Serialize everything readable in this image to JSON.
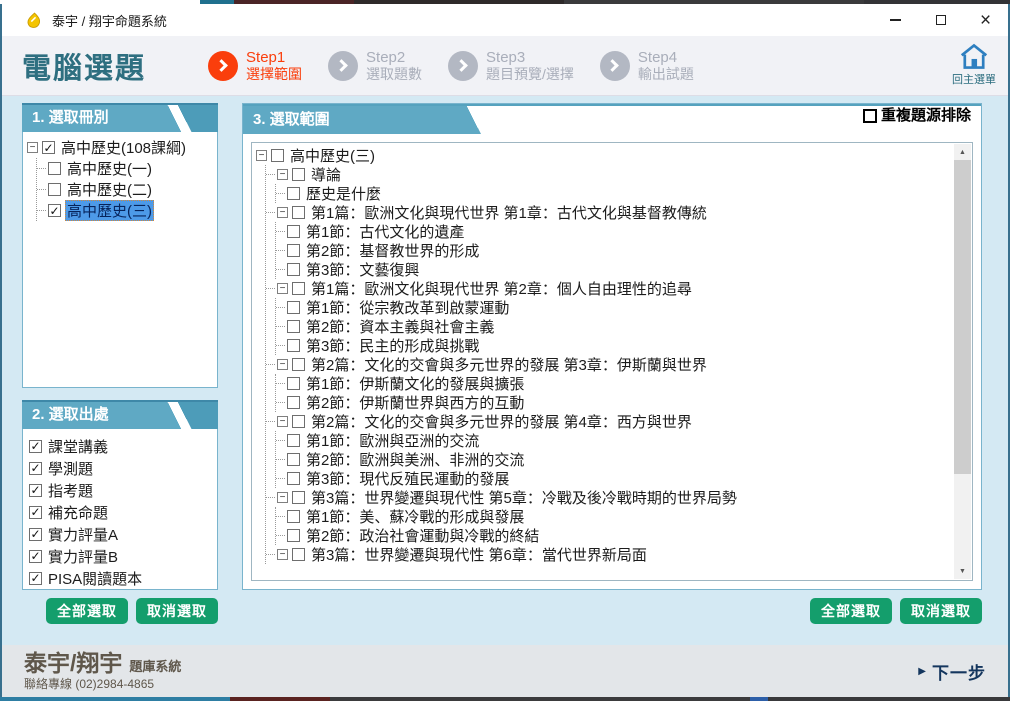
{
  "window": {
    "title": "泰宇 / 翔宇命題系統"
  },
  "header": {
    "title": "電腦選題",
    "home_label": "回主選單",
    "steps": [
      {
        "name": "Step1",
        "label": "選擇範圍",
        "active": true
      },
      {
        "name": "Step2",
        "label": "選取題數",
        "active": false
      },
      {
        "name": "Step3",
        "label": "題目預覽/選擇",
        "active": false
      },
      {
        "name": "Step4",
        "label": "輸出試題",
        "active": false
      }
    ]
  },
  "buttons": {
    "select_all": "全部選取",
    "deselect": "取消選取"
  },
  "panel1": {
    "title": "1. 選取冊別",
    "tree": {
      "label": "高中歷史(108課綱)",
      "checked": true,
      "expanded": true,
      "children": [
        {
          "label": "高中歷史(一)",
          "checked": false,
          "selected": false
        },
        {
          "label": "高中歷史(二)",
          "checked": false,
          "selected": false
        },
        {
          "label": "高中歷史(三)",
          "checked": true,
          "selected": true
        }
      ]
    }
  },
  "panel2": {
    "title": "2. 選取出處",
    "items": [
      {
        "label": "課堂講義",
        "checked": true
      },
      {
        "label": "學測題",
        "checked": true
      },
      {
        "label": "指考題",
        "checked": true
      },
      {
        "label": "補充命題",
        "checked": true
      },
      {
        "label": "實力評量A",
        "checked": true
      },
      {
        "label": "實力評量B",
        "checked": true
      },
      {
        "label": "PISA閱讀題本",
        "checked": true
      }
    ]
  },
  "panel3": {
    "title": "3. 選取範圍",
    "dedupe": {
      "label": "重複題源排除",
      "checked": false
    },
    "root": {
      "label": "高中歷史(三)",
      "checked": false,
      "expanded": true
    },
    "chapters": [
      {
        "label": "導論",
        "checked": false,
        "sections": [
          "歷史是什麼"
        ]
      },
      {
        "label": "第1篇：歐洲文化與現代世界 第1章：古代文化與基督教傳統",
        "checked": false,
        "sections": [
          "第1節：古代文化的遺產",
          "第2節：基督教世界的形成",
          "第3節：文藝復興"
        ]
      },
      {
        "label": "第1篇：歐洲文化與現代世界 第2章：個人自由理性的追尋",
        "checked": false,
        "sections": [
          "第1節：從宗教改革到啟蒙運動",
          "第2節：資本主義與社會主義",
          "第3節：民主的形成與挑戰"
        ]
      },
      {
        "label": "第2篇：文化的交會與多元世界的發展 第3章：伊斯蘭與世界",
        "checked": false,
        "sections": [
          "第1節：伊斯蘭文化的發展與擴張",
          "第2節：伊斯蘭世界與西方的互動"
        ]
      },
      {
        "label": "第2篇：文化的交會與多元世界的發展 第4章：西方與世界",
        "checked": false,
        "sections": [
          "第1節：歐洲與亞洲的交流",
          "第2節：歐洲與美洲、非洲的交流",
          "第3節：現代反殖民運動的發展"
        ]
      },
      {
        "label": "第3篇：世界變遷與現代性 第5章：冷戰及後冷戰時期的世界局勢",
        "checked": false,
        "sections": [
          "第1節：美、蘇冷戰的形成與發展",
          "第2節：政治社會運動與冷戰的終結"
        ]
      },
      {
        "label": "第3篇：世界變遷與現代性 第6章：當代世界新局面",
        "checked": false,
        "sections": []
      }
    ]
  },
  "footer": {
    "brand": "泰宇/翔宇",
    "brand_suffix": "題庫系統",
    "contact": "聯絡專線 (02)2984-4865",
    "next_arrow": "▶",
    "next_label": "下一步"
  },
  "colors": {
    "accent_teal": "#5FA9C4",
    "header_teal_dark": "#3E88A8",
    "active_orange": "#FA3E0C",
    "inactive_gray": "#B3B8C3",
    "button_green": "#149E6C",
    "selection_blue": "#4D9AE8",
    "content_bg": "#D4E9F3",
    "footer_bg": "#E3E6E9"
  }
}
